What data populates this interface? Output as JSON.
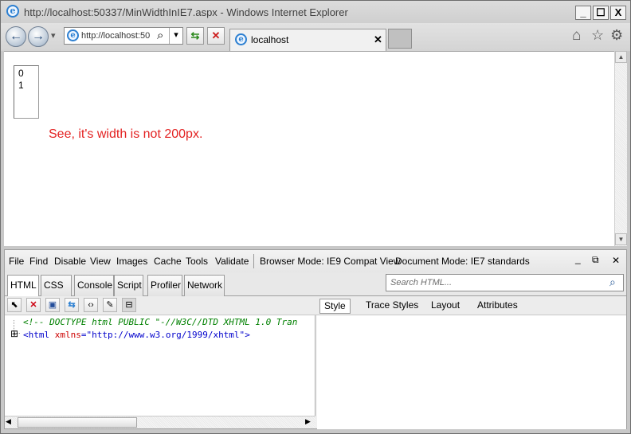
{
  "window": {
    "title": "http://localhost:50337/MinWidthInIE7.aspx - Windows Internet Explorer",
    "minimize_glyph": "_",
    "maximize_glyph": "☐",
    "close_glyph": "X"
  },
  "navbar": {
    "back_glyph": "←",
    "forward_glyph": "→",
    "dropdown_glyph": "▾",
    "address": "http://localhost:50",
    "search_glyph": "⌕",
    "address_dropdown_glyph": "▾",
    "refresh_glyph": "⇆",
    "stop_glyph": "✕",
    "tab_label": "localhost",
    "tab_close_glyph": "✕",
    "home_glyph": "⌂",
    "favorites_glyph": "☆",
    "tools_glyph": "⚙"
  },
  "page": {
    "list_options": [
      "0",
      "1"
    ],
    "note": "See, it's width is not 200px."
  },
  "devtools": {
    "menu": [
      "File",
      "Find",
      "Disable",
      "View",
      "Images",
      "Cache",
      "Tools",
      "Validate"
    ],
    "browser_mode": "Browser Mode: IE9 Compat View",
    "document_mode": "Document Mode: IE7 standards",
    "window_controls": [
      "_",
      "⧉",
      "✕"
    ],
    "tabs": [
      "HTML",
      "CSS",
      "Console",
      "Script",
      "Profiler",
      "Network"
    ],
    "search_placeholder": "Search HTML...",
    "style_tabs": [
      "Style",
      "Trace Styles",
      "Layout",
      "Attributes"
    ],
    "code_lines": [
      "<!-- DOCTYPE html PUBLIC \"-//W3C//DTD XHTML 1.0 Tran",
      "<html xmlns=\"http://www.w3.org/1999/xhtml\">"
    ],
    "expand_glyph": "⊞",
    "scroll_left": "◀",
    "scroll_right": "▶"
  },
  "colors": {
    "note": "#e32222",
    "comment": "#008000",
    "tag": "#0000cc",
    "attr_name": "#cc0000",
    "attr_value": "#0000cc"
  }
}
